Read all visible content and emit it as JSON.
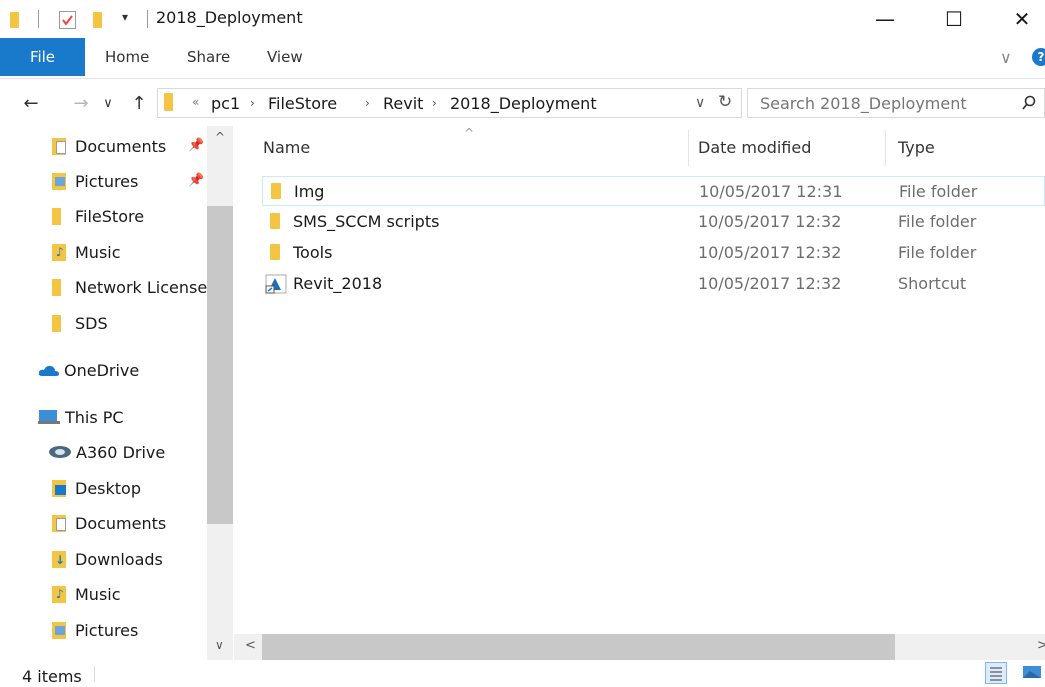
{
  "title": "2018_Deployment",
  "window_buttons": {
    "minimize": "—",
    "maximize": "☐",
    "close": "✕"
  },
  "ribbon": {
    "tabs": [
      "File",
      "Home",
      "Share",
      "View"
    ],
    "help": "?",
    "expand": "∨",
    "accent": "#1979ca"
  },
  "address": {
    "overflow": "«",
    "crumbs": [
      "pc1",
      "FileStore",
      "Revit",
      "2018_Deployment"
    ],
    "sep": "›",
    "dropdown": "∨",
    "refresh": "↻"
  },
  "search": {
    "placeholder": "Search 2018_Deployment"
  },
  "nav": {
    "back": "←",
    "forward": "→",
    "recent": "∨",
    "up": "↑",
    "quick_access": [
      {
        "label": "Documents",
        "icon": "documents-icon",
        "pinned": true
      },
      {
        "label": "Pictures",
        "icon": "pictures-icon",
        "pinned": true
      },
      {
        "label": "FileStore",
        "icon": "folder-icon"
      },
      {
        "label": "Music",
        "icon": "music-icon"
      },
      {
        "label": "Network License",
        "icon": "folder-icon"
      },
      {
        "label": "SDS",
        "icon": "folder-icon"
      }
    ],
    "onedrive": "OneDrive",
    "this_pc": "This PC",
    "pc_items": [
      {
        "label": "A360 Drive",
        "icon": "a360-icon"
      },
      {
        "label": "Desktop",
        "icon": "desktop-icon"
      },
      {
        "label": "Documents",
        "icon": "documents-icon"
      },
      {
        "label": "Downloads",
        "icon": "downloads-icon"
      },
      {
        "label": "Music",
        "icon": "music-icon"
      },
      {
        "label": "Pictures",
        "icon": "pictures-icon"
      }
    ]
  },
  "columns": {
    "name": "Name",
    "date": "Date modified",
    "type": "Type"
  },
  "files": [
    {
      "name": "Img",
      "date": "10/05/2017 12:31",
      "type": "File folder",
      "icon": "folder-icon"
    },
    {
      "name": "SMS_SCCM scripts",
      "date": "10/05/2017 12:32",
      "type": "File folder",
      "icon": "folder-icon"
    },
    {
      "name": "Tools",
      "date": "10/05/2017 12:32",
      "type": "File folder",
      "icon": "folder-icon"
    },
    {
      "name": "Revit_2018",
      "date": "10/05/2017 12:32",
      "type": "Shortcut",
      "icon": "revit-shortcut-icon"
    }
  ],
  "status": {
    "count": "4 items"
  },
  "colors": {
    "folder": "#f4c542",
    "selection_border": "#cce8ff",
    "onedrive": "#1979ca"
  }
}
